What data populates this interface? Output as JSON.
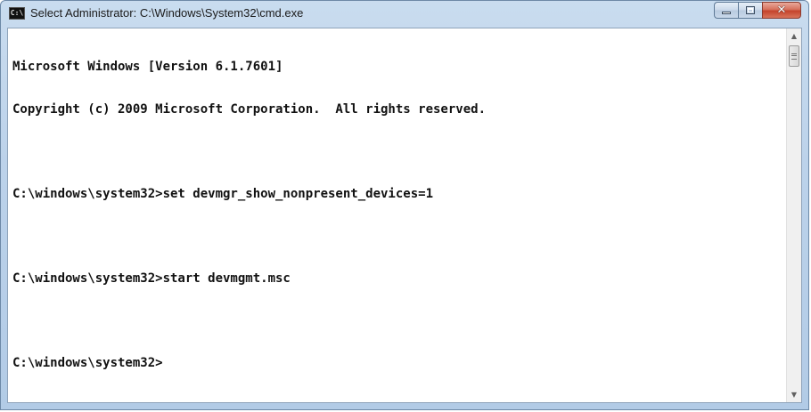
{
  "window": {
    "title": "Select Administrator: C:\\Windows\\System32\\cmd.exe",
    "app_icon_text": "C:\\",
    "icon": "cmd-icon",
    "buttons": {
      "minimize_icon": "minimize-icon",
      "maximize_icon": "maximize-icon",
      "close_icon": "close-icon",
      "close_glyph": "✕"
    },
    "colors": {
      "frame": "#bcd2ea",
      "close": "#c4442c",
      "console_bg": "#ffffff",
      "console_text": "#111111"
    }
  },
  "console": {
    "header_line_1": "Microsoft Windows [Version 6.1.7601]",
    "header_line_2": "Copyright (c) 2009 Microsoft Corporation.  All rights reserved.",
    "command_1": "C:\\windows\\system32>set devmgr_show_nonpresent_devices=1",
    "command_2": "C:\\windows\\system32>start devmgmt.msc",
    "prompt": "C:\\windows\\system32>"
  },
  "scrollbar": {
    "up_arrow": "▲",
    "down_arrow": "▼"
  }
}
